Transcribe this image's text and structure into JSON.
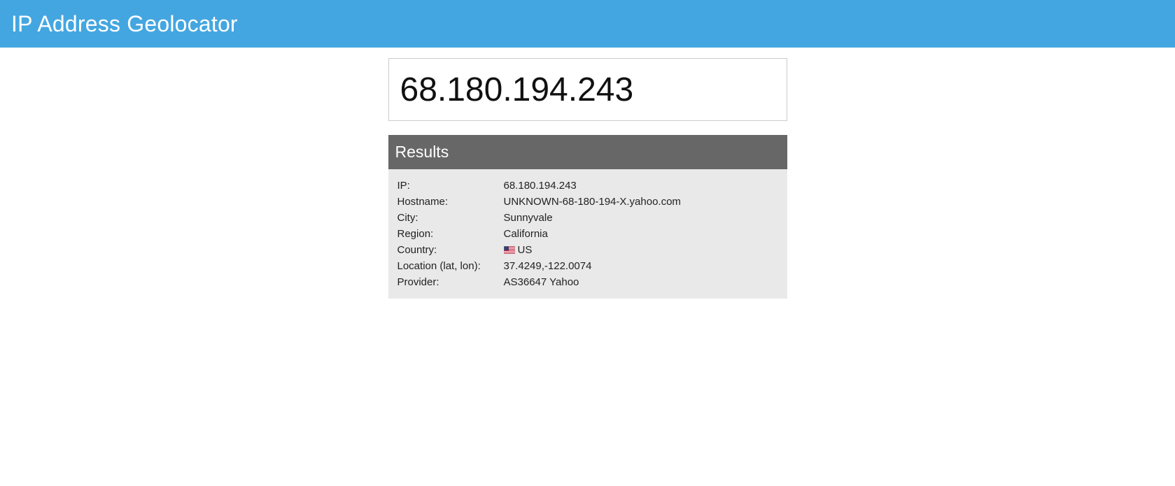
{
  "header": {
    "title": "IP Address Geolocator"
  },
  "search": {
    "value": "68.180.194.243"
  },
  "results": {
    "title": "Results",
    "rows": [
      {
        "label": "IP:",
        "value": "68.180.194.243"
      },
      {
        "label": "Hostname:",
        "value": "UNKNOWN-68-180-194-X.yahoo.com"
      },
      {
        "label": "City:",
        "value": "Sunnyvale"
      },
      {
        "label": "Region:",
        "value": "California"
      },
      {
        "label": "Country:",
        "value": "US",
        "icon": "us-flag-icon"
      },
      {
        "label": "Location (lat, lon):",
        "value": "37.4249,-122.0074"
      },
      {
        "label": "Provider:",
        "value": "AS36647 Yahoo"
      }
    ]
  },
  "colors": {
    "header_bg": "#44a6e0",
    "results_header_bg": "#676767",
    "results_body_bg": "#e9e9e9"
  }
}
